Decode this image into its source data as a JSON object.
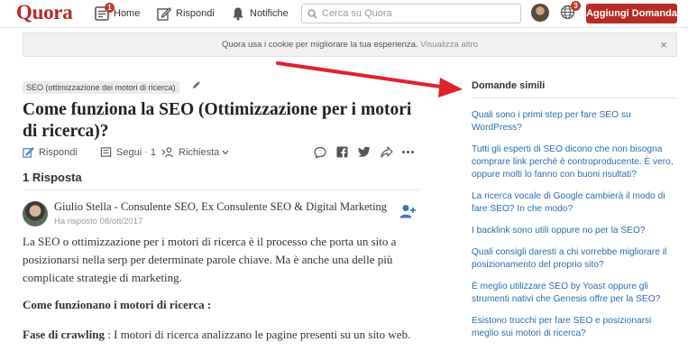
{
  "nav": {
    "logo": "Quora",
    "home_label": "Home",
    "home_badge": "1",
    "answer_label": "Rispondi",
    "notifications_label": "Notifiche",
    "search_placeholder": "Cerca su Quora",
    "globe_badge": "3",
    "ask_button": "Aggiungi Domanda"
  },
  "cookie_banner": {
    "text": "Quora usa i cookie per migliorare la tua esperienza.",
    "link": "Visualizza altro",
    "close": "×"
  },
  "question": {
    "topic": "SEO (ottimizzazione dei motori di ricerca)",
    "title": "Come funziona la SEO (Ottimizzazione per i motori di ricerca)?",
    "actions": {
      "answer": "Rispondi",
      "follow": "Segui",
      "follow_count": "1",
      "request": "Richiesta"
    },
    "answers_count": "1 Risposta"
  },
  "answer": {
    "author": "Giulio Stella - Consulente SEO, Ex Consulente SEO & Digital Marketing",
    "date": "Ha risposto 08/ott/2017",
    "paragraph1": "La SEO o ottimizzazione per i motori di ricerca è il processo che porta un sito a posizionarsi nella serp per determinate parole chiave. Ma è anche una delle più complicate strategie di marketing.",
    "heading": "Come funzionano i motori di ricerca :",
    "crawl_label": "Fase di crawling",
    "crawl_text": " : I motori di ricerca analizzano le pagine presenti su un sito web."
  },
  "related": {
    "title": "Domande simili",
    "items": [
      "Quali sono i primi step per fare SEO su WordPress?",
      "Tutti gli esperti di SEO dicono che non bisogna comprare link perché è controproducente. È vero, oppure molti lo fanno con buoni risultati?",
      "La ricerca vocale di Google cambierà il modo di fare SEO? In che modo?",
      "I backlink sono utili oppure no per la SEO?",
      "Quali consigli daresti a chi vorrebbe migliorare il posizionamento del proprio sito?",
      "È meglio utilizzare SEO by Yoast oppure gli strumenti nativi che Genesis offre per la SEO?",
      "Esistono trucchi per fare SEO e posizionarsi meglio sui motori di ricerca?"
    ]
  },
  "colors": {
    "brand": "#b92b27",
    "link": "#2b6dad",
    "arrow": "#e3202b"
  }
}
